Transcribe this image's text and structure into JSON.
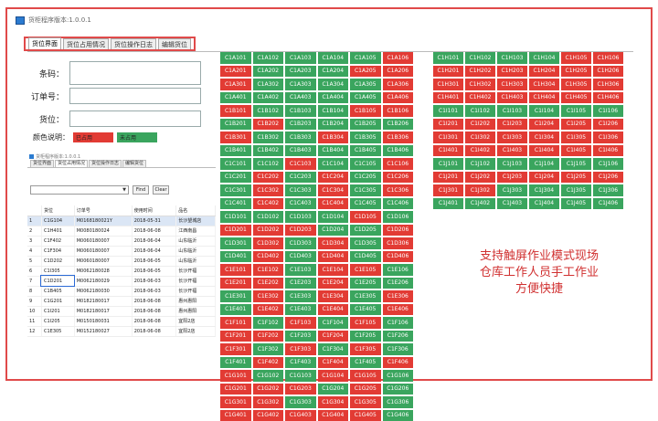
{
  "window": {
    "title": "货柜程序版本:1.0.0.1"
  },
  "tabs": [
    "货位界面",
    "货位占用情况",
    "货位操作日志",
    "编辑货位"
  ],
  "form": {
    "code_label": "条码：",
    "order_label": "订单号：",
    "slot_label": "货位：",
    "legend_label": "颜色说明：",
    "occupied_label": "已占用",
    "free_label": "未占用"
  },
  "colors": {
    "occupied": "#e23b34",
    "free": "#3aa55e",
    "highlight": "#e04a4a"
  },
  "mini": {
    "title": "货柜程序版本:1.0.0.1",
    "tabs": [
      "货位界面",
      "货位占用情况",
      "货位操作日志",
      "编辑货位"
    ],
    "find_label": "Find",
    "clear_label": "Clear",
    "columns": [
      "",
      "货位",
      "订单号",
      "使用时间",
      "品名"
    ],
    "rows": [
      [
        "1",
        "C1G104",
        "M0168180021Y",
        "2018-05-31",
        "长沙望城店"
      ],
      [
        "2",
        "C1H401",
        "M0080180024",
        "2018-06-08",
        "江西南昌"
      ],
      [
        "3",
        "C1F402",
        "M0060180007",
        "2018-06-04",
        "山东临沂"
      ],
      [
        "4",
        "C1F304",
        "M0060180007",
        "2018-06-04",
        "山东临沂"
      ],
      [
        "5",
        "C1D202",
        "M0060180007",
        "2018-06-05",
        "山东临沂"
      ],
      [
        "6",
        "C1I305",
        "M0062180028",
        "2018-06-05",
        "长沙开福"
      ],
      [
        "7",
        "C1D201",
        "M0062180029",
        "2018-06-03",
        "长沙开福"
      ],
      [
        "8",
        "C1B405",
        "M0062180030",
        "2018-06-03",
        "长沙开福"
      ],
      [
        "9",
        "C1G201",
        "M0182180017",
        "2018-06-08",
        "惠州惠阳"
      ],
      [
        "10",
        "C1I201",
        "M0182180017",
        "2018-06-08",
        "惠州惠阳"
      ],
      [
        "11",
        "C1I205",
        "M0150180031",
        "2018-06-08",
        "宜阳2店"
      ],
      [
        "12",
        "C1E305",
        "M0152180027",
        "2018-06-08",
        "宜阳2店"
      ]
    ]
  },
  "left_grid": {
    "rows": [
      {
        "cells": [
          "C1A101",
          "C1A102",
          "C1A103",
          "C1A104",
          "C1A105",
          "C1A106"
        ],
        "state": [
          "g",
          "g",
          "g",
          "g",
          "g",
          "r"
        ]
      },
      {
        "cells": [
          "C1A201",
          "C1A202",
          "C1A203",
          "C1A204",
          "C1A205",
          "C1A206"
        ],
        "state": [
          "r",
          "g",
          "g",
          "g",
          "r",
          "r"
        ]
      },
      {
        "cells": [
          "C1A301",
          "C1A302",
          "C1A303",
          "C1A304",
          "C1A305",
          "C1A306"
        ],
        "state": [
          "r",
          "g",
          "g",
          "g",
          "g",
          "r"
        ]
      },
      {
        "cells": [
          "C1A401",
          "C1A402",
          "C1A403",
          "C1A404",
          "C1A405",
          "C1A406"
        ],
        "state": [
          "g",
          "g",
          "g",
          "g",
          "g",
          "r"
        ]
      },
      {
        "cells": [
          "C1B101",
          "C1B102",
          "C1B103",
          "C1B104",
          "C1B105",
          "C1B106"
        ],
        "state": [
          "r",
          "g",
          "g",
          "g",
          "r",
          "r"
        ]
      },
      {
        "cells": [
          "C1B201",
          "C1B202",
          "C1B203",
          "C1B204",
          "C1B205",
          "C1B206"
        ],
        "state": [
          "g",
          "r",
          "g",
          "g",
          "g",
          "g"
        ]
      },
      {
        "cells": [
          "C1B301",
          "C1B302",
          "C1B303",
          "C1B304",
          "C1B305",
          "C1B306"
        ],
        "state": [
          "r",
          "g",
          "g",
          "r",
          "g",
          "r"
        ]
      },
      {
        "cells": [
          "C1B401",
          "C1B402",
          "C1B403",
          "C1B404",
          "C1B405",
          "C1B406"
        ],
        "state": [
          "g",
          "g",
          "g",
          "g",
          "g",
          "g"
        ]
      },
      {
        "cells": [
          "C1C101",
          "C1C102",
          "C1C103",
          "C1C104",
          "C1C105",
          "C1C106"
        ],
        "state": [
          "g",
          "g",
          "r",
          "g",
          "g",
          "r"
        ]
      },
      {
        "cells": [
          "C1C201",
          "C1C202",
          "C1C203",
          "C1C204",
          "C1C205",
          "C1C206"
        ],
        "state": [
          "g",
          "r",
          "g",
          "r",
          "g",
          "r"
        ]
      },
      {
        "cells": [
          "C1C301",
          "C1C302",
          "C1C303",
          "C1C304",
          "C1C305",
          "C1C306"
        ],
        "state": [
          "g",
          "r",
          "g",
          "r",
          "g",
          "r"
        ]
      },
      {
        "cells": [
          "C1C401",
          "C1C402",
          "C1C403",
          "C1C404",
          "C1C405",
          "C1C406"
        ],
        "state": [
          "g",
          "r",
          "g",
          "r",
          "g",
          "g"
        ]
      },
      {
        "cells": [
          "C1D101",
          "C1D102",
          "C1D103",
          "C1D104",
          "C1D105",
          "C1D106"
        ],
        "state": [
          "g",
          "g",
          "g",
          "g",
          "r",
          "g"
        ]
      },
      {
        "cells": [
          "C1D201",
          "C1D202",
          "C1D203",
          "C1D204",
          "C1D205",
          "C1D206"
        ],
        "state": [
          "r",
          "r",
          "r",
          "g",
          "g",
          "r"
        ]
      },
      {
        "cells": [
          "C1D301",
          "C1D302",
          "C1D303",
          "C1D304",
          "C1D305",
          "C1D306"
        ],
        "state": [
          "g",
          "r",
          "g",
          "r",
          "g",
          "r"
        ]
      },
      {
        "cells": [
          "C1D401",
          "C1D402",
          "C1D403",
          "C1D404",
          "C1D405",
          "C1D406"
        ],
        "state": [
          "g",
          "r",
          "g",
          "r",
          "g",
          "r"
        ]
      },
      {
        "cells": [
          "C1E101",
          "C1E102",
          "C1E103",
          "C1E104",
          "C1E105",
          "C1E106"
        ],
        "state": [
          "r",
          "r",
          "g",
          "r",
          "r",
          "g"
        ]
      },
      {
        "cells": [
          "C1E201",
          "C1E202",
          "C1E203",
          "C1E204",
          "C1E205",
          "C1E206"
        ],
        "state": [
          "r",
          "r",
          "g",
          "r",
          "g",
          "g"
        ]
      },
      {
        "cells": [
          "C1E301",
          "C1E302",
          "C1E303",
          "C1E304",
          "C1E305",
          "C1E306"
        ],
        "state": [
          "g",
          "r",
          "g",
          "r",
          "g",
          "r"
        ]
      },
      {
        "cells": [
          "C1E401",
          "C1E402",
          "C1E403",
          "C1E404",
          "C1E405",
          "C1E406"
        ],
        "state": [
          "g",
          "r",
          "g",
          "r",
          "g",
          "r"
        ]
      },
      {
        "cells": [
          "C1F101",
          "C1F102",
          "C1F103",
          "C1F104",
          "C1F105",
          "C1F106"
        ],
        "state": [
          "r",
          "g",
          "r",
          "g",
          "r",
          "g"
        ]
      },
      {
        "cells": [
          "C1F201",
          "C1F202",
          "C1F203",
          "C1F204",
          "C1F205",
          "C1F206"
        ],
        "state": [
          "r",
          "r",
          "g",
          "r",
          "g",
          "g"
        ]
      },
      {
        "cells": [
          "C1F301",
          "C1F302",
          "C1F303",
          "C1F304",
          "C1F305",
          "C1F306"
        ],
        "state": [
          "r",
          "g",
          "r",
          "g",
          "r",
          "g"
        ]
      },
      {
        "cells": [
          "C1F401",
          "C1F402",
          "C1F403",
          "C1F404",
          "C1F405",
          "C1F406"
        ],
        "state": [
          "g",
          "r",
          "g",
          "r",
          "g",
          "r"
        ]
      },
      {
        "cells": [
          "C1G101",
          "C1G102",
          "C1G103",
          "C1G104",
          "C1G105",
          "C1G106"
        ],
        "state": [
          "r",
          "g",
          "g",
          "r",
          "r",
          "g"
        ]
      },
      {
        "cells": [
          "C1G201",
          "C1G202",
          "C1G203",
          "C1G204",
          "C1G205",
          "C1G206"
        ],
        "state": [
          "r",
          "r",
          "r",
          "g",
          "r",
          "g"
        ]
      },
      {
        "cells": [
          "C1G301",
          "C1G302",
          "C1G303",
          "C1G304",
          "C1G305",
          "C1G306"
        ],
        "state": [
          "r",
          "r",
          "g",
          "r",
          "r",
          "g"
        ]
      },
      {
        "cells": [
          "C1G401",
          "C1G402",
          "C1G403",
          "C1G404",
          "C1G405",
          "C1G406"
        ],
        "state": [
          "r",
          "r",
          "r",
          "r",
          "r",
          "g"
        ]
      }
    ]
  },
  "right_grid": {
    "rows": [
      {
        "cells": [
          "C1H101",
          "C1H102",
          "C1H103",
          "C1H104",
          "C1H105",
          "C1H106"
        ],
        "state": [
          "g",
          "g",
          "g",
          "g",
          "r",
          "r"
        ]
      },
      {
        "cells": [
          "C1H201",
          "C1H202",
          "C1H203",
          "C1H204",
          "C1H205",
          "C1H206"
        ],
        "state": [
          "r",
          "r",
          "r",
          "r",
          "r",
          "r"
        ]
      },
      {
        "cells": [
          "C1H301",
          "C1H302",
          "C1H303",
          "C1H304",
          "C1H305",
          "C1H306"
        ],
        "state": [
          "r",
          "r",
          "r",
          "r",
          "r",
          "r"
        ]
      },
      {
        "cells": [
          "C1H401",
          "C1H402",
          "C1H403",
          "C1H404",
          "C1H405",
          "C1H406"
        ],
        "state": [
          "r",
          "r",
          "r",
          "r",
          "r",
          "r"
        ]
      },
      {
        "cells": [
          "C1I101",
          "C1I102",
          "C1I103",
          "C1I104",
          "C1I105",
          "C1I106"
        ],
        "state": [
          "g",
          "g",
          "g",
          "g",
          "g",
          "g"
        ]
      },
      {
        "cells": [
          "C1I201",
          "C1I202",
          "C1I203",
          "C1I204",
          "C1I205",
          "C1I206"
        ],
        "state": [
          "r",
          "r",
          "r",
          "r",
          "r",
          "r"
        ]
      },
      {
        "cells": [
          "C1I301",
          "C1I302",
          "C1I303",
          "C1I304",
          "C1I305",
          "C1I306"
        ],
        "state": [
          "r",
          "r",
          "r",
          "r",
          "r",
          "r"
        ]
      },
      {
        "cells": [
          "C1I401",
          "C1I402",
          "C1I403",
          "C1I404",
          "C1I405",
          "C1I406"
        ],
        "state": [
          "r",
          "r",
          "r",
          "r",
          "r",
          "r"
        ]
      },
      {
        "cells": [
          "C1J101",
          "C1J102",
          "C1J103",
          "C1J104",
          "C1J105",
          "C1J106"
        ],
        "state": [
          "g",
          "g",
          "g",
          "g",
          "g",
          "g"
        ]
      },
      {
        "cells": [
          "C1J201",
          "C1J202",
          "C1J203",
          "C1J204",
          "C1J205",
          "C1J206"
        ],
        "state": [
          "r",
          "r",
          "r",
          "r",
          "r",
          "r"
        ]
      },
      {
        "cells": [
          "C1J301",
          "C1J302",
          "C1J303",
          "C1J304",
          "C1J305",
          "C1J306"
        ],
        "state": [
          "r",
          "r",
          "g",
          "g",
          "g",
          "g"
        ]
      },
      {
        "cells": [
          "C1J401",
          "C1J402",
          "C1J403",
          "C1J404",
          "C1J405",
          "C1J406"
        ],
        "state": [
          "g",
          "g",
          "g",
          "g",
          "g",
          "g"
        ]
      }
    ]
  },
  "promo": {
    "lines": [
      "支持触屏作业模式现场",
      "仓库工作人员手工作业",
      "方便快捷"
    ]
  }
}
